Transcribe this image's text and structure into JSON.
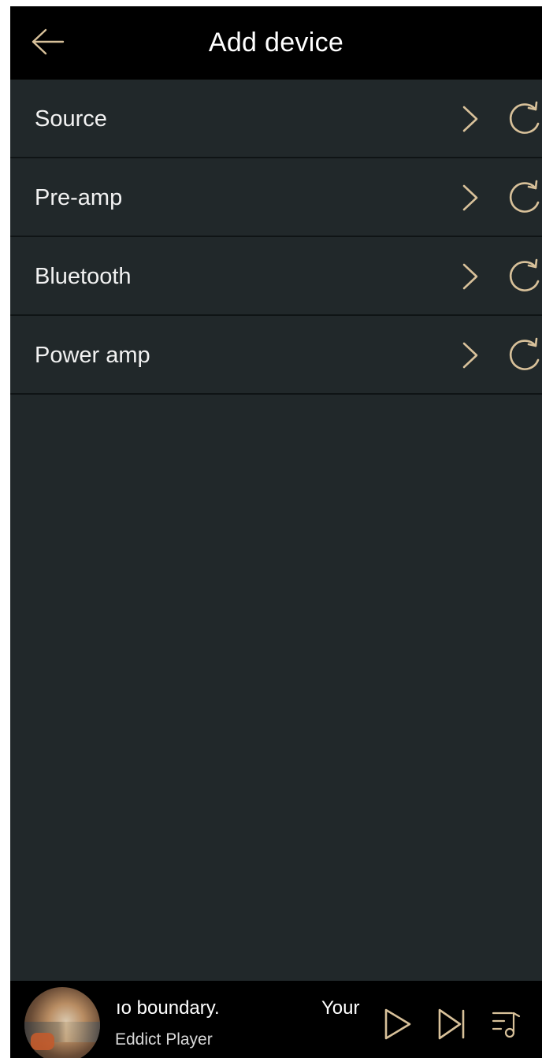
{
  "header": {
    "title": "Add device",
    "back_icon": "arrow-left-icon"
  },
  "colors": {
    "header_bg": "#000000",
    "screen_bg": "#21282a",
    "accent_gold": "#d8c19a",
    "text_primary": "#f2f2f2"
  },
  "devices": [
    {
      "label": "Source",
      "chevron_icon": "chevron-right-icon",
      "refresh_icon": "refresh-icon"
    },
    {
      "label": "Pre-amp",
      "chevron_icon": "chevron-right-icon",
      "refresh_icon": "refresh-icon"
    },
    {
      "label": "Bluetooth",
      "chevron_icon": "chevron-right-icon",
      "refresh_icon": "refresh-icon"
    },
    {
      "label": "Power amp",
      "chevron_icon": "chevron-right-icon",
      "refresh_icon": "refresh-icon"
    }
  ],
  "player": {
    "track_title": "ıo boundary.",
    "marquee_next": "Your",
    "artist": "Eddict Player",
    "icons": {
      "play": "play-icon",
      "next": "skip-next-icon",
      "playlist": "playlist-icon"
    }
  }
}
